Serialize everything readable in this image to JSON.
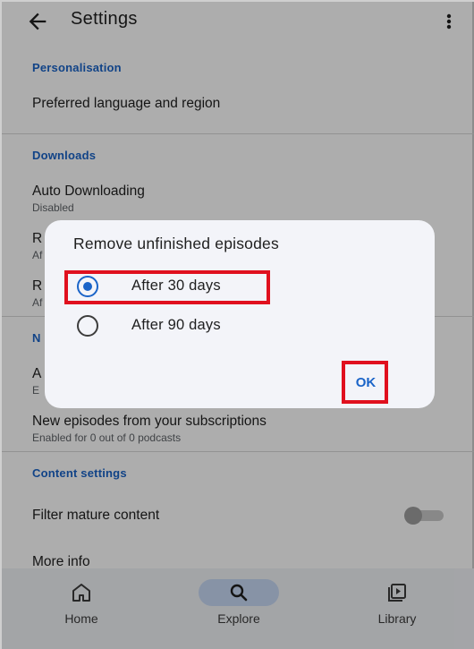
{
  "colors": {
    "accent": "#1a64c8",
    "highlight": "#e0101e",
    "nav_pill": "#c8d9f5"
  },
  "appbar": {
    "title": "Settings",
    "back_icon": "arrow-back-icon",
    "menu_icon": "more-vertical-icon"
  },
  "sections": {
    "personalisation": {
      "header": "Personalisation",
      "items": [
        {
          "title": "Preferred language and region"
        }
      ]
    },
    "downloads": {
      "header": "Downloads",
      "items": [
        {
          "title": "Auto Downloading",
          "subtitle": "Disabled"
        },
        {
          "title": "R",
          "subtitle": "Af"
        },
        {
          "title": "R",
          "subtitle": "Af"
        }
      ]
    },
    "notifications": {
      "header": "N",
      "items": [
        {
          "title": "A",
          "subtitle": "E"
        },
        {
          "title": "New episodes from your subscriptions",
          "subtitle": "Enabled for 0 out of 0 podcasts"
        }
      ]
    },
    "content_settings": {
      "header": "Content settings",
      "items": [
        {
          "title": "Filter mature content",
          "toggle_on": false
        },
        {
          "title": "More info"
        }
      ]
    }
  },
  "dialog": {
    "title": "Remove unfinished episodes",
    "options": [
      {
        "label": "After 30 days",
        "selected": true
      },
      {
        "label": "After 90 days",
        "selected": false
      }
    ],
    "ok_label": "OK"
  },
  "bottom_nav": {
    "items": [
      {
        "label": "Home",
        "icon": "home-icon",
        "active": false
      },
      {
        "label": "Explore",
        "icon": "search-icon",
        "active": true
      },
      {
        "label": "Library",
        "icon": "library-icon",
        "active": false
      }
    ]
  }
}
